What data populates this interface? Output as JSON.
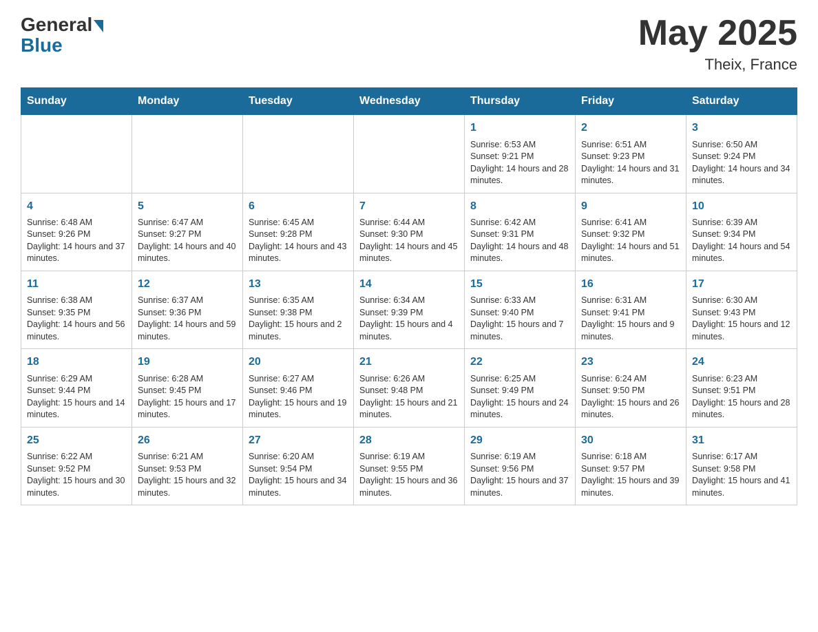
{
  "header": {
    "logo_general": "General",
    "logo_blue": "Blue",
    "title": "May 2025",
    "subtitle": "Theix, France"
  },
  "weekdays": [
    "Sunday",
    "Monday",
    "Tuesday",
    "Wednesday",
    "Thursday",
    "Friday",
    "Saturday"
  ],
  "weeks": [
    [
      {
        "day": "",
        "info": ""
      },
      {
        "day": "",
        "info": ""
      },
      {
        "day": "",
        "info": ""
      },
      {
        "day": "",
        "info": ""
      },
      {
        "day": "1",
        "info": "Sunrise: 6:53 AM\nSunset: 9:21 PM\nDaylight: 14 hours and 28 minutes."
      },
      {
        "day": "2",
        "info": "Sunrise: 6:51 AM\nSunset: 9:23 PM\nDaylight: 14 hours and 31 minutes."
      },
      {
        "day": "3",
        "info": "Sunrise: 6:50 AM\nSunset: 9:24 PM\nDaylight: 14 hours and 34 minutes."
      }
    ],
    [
      {
        "day": "4",
        "info": "Sunrise: 6:48 AM\nSunset: 9:26 PM\nDaylight: 14 hours and 37 minutes."
      },
      {
        "day": "5",
        "info": "Sunrise: 6:47 AM\nSunset: 9:27 PM\nDaylight: 14 hours and 40 minutes."
      },
      {
        "day": "6",
        "info": "Sunrise: 6:45 AM\nSunset: 9:28 PM\nDaylight: 14 hours and 43 minutes."
      },
      {
        "day": "7",
        "info": "Sunrise: 6:44 AM\nSunset: 9:30 PM\nDaylight: 14 hours and 45 minutes."
      },
      {
        "day": "8",
        "info": "Sunrise: 6:42 AM\nSunset: 9:31 PM\nDaylight: 14 hours and 48 minutes."
      },
      {
        "day": "9",
        "info": "Sunrise: 6:41 AM\nSunset: 9:32 PM\nDaylight: 14 hours and 51 minutes."
      },
      {
        "day": "10",
        "info": "Sunrise: 6:39 AM\nSunset: 9:34 PM\nDaylight: 14 hours and 54 minutes."
      }
    ],
    [
      {
        "day": "11",
        "info": "Sunrise: 6:38 AM\nSunset: 9:35 PM\nDaylight: 14 hours and 56 minutes."
      },
      {
        "day": "12",
        "info": "Sunrise: 6:37 AM\nSunset: 9:36 PM\nDaylight: 14 hours and 59 minutes."
      },
      {
        "day": "13",
        "info": "Sunrise: 6:35 AM\nSunset: 9:38 PM\nDaylight: 15 hours and 2 minutes."
      },
      {
        "day": "14",
        "info": "Sunrise: 6:34 AM\nSunset: 9:39 PM\nDaylight: 15 hours and 4 minutes."
      },
      {
        "day": "15",
        "info": "Sunrise: 6:33 AM\nSunset: 9:40 PM\nDaylight: 15 hours and 7 minutes."
      },
      {
        "day": "16",
        "info": "Sunrise: 6:31 AM\nSunset: 9:41 PM\nDaylight: 15 hours and 9 minutes."
      },
      {
        "day": "17",
        "info": "Sunrise: 6:30 AM\nSunset: 9:43 PM\nDaylight: 15 hours and 12 minutes."
      }
    ],
    [
      {
        "day": "18",
        "info": "Sunrise: 6:29 AM\nSunset: 9:44 PM\nDaylight: 15 hours and 14 minutes."
      },
      {
        "day": "19",
        "info": "Sunrise: 6:28 AM\nSunset: 9:45 PM\nDaylight: 15 hours and 17 minutes."
      },
      {
        "day": "20",
        "info": "Sunrise: 6:27 AM\nSunset: 9:46 PM\nDaylight: 15 hours and 19 minutes."
      },
      {
        "day": "21",
        "info": "Sunrise: 6:26 AM\nSunset: 9:48 PM\nDaylight: 15 hours and 21 minutes."
      },
      {
        "day": "22",
        "info": "Sunrise: 6:25 AM\nSunset: 9:49 PM\nDaylight: 15 hours and 24 minutes."
      },
      {
        "day": "23",
        "info": "Sunrise: 6:24 AM\nSunset: 9:50 PM\nDaylight: 15 hours and 26 minutes."
      },
      {
        "day": "24",
        "info": "Sunrise: 6:23 AM\nSunset: 9:51 PM\nDaylight: 15 hours and 28 minutes."
      }
    ],
    [
      {
        "day": "25",
        "info": "Sunrise: 6:22 AM\nSunset: 9:52 PM\nDaylight: 15 hours and 30 minutes."
      },
      {
        "day": "26",
        "info": "Sunrise: 6:21 AM\nSunset: 9:53 PM\nDaylight: 15 hours and 32 minutes."
      },
      {
        "day": "27",
        "info": "Sunrise: 6:20 AM\nSunset: 9:54 PM\nDaylight: 15 hours and 34 minutes."
      },
      {
        "day": "28",
        "info": "Sunrise: 6:19 AM\nSunset: 9:55 PM\nDaylight: 15 hours and 36 minutes."
      },
      {
        "day": "29",
        "info": "Sunrise: 6:19 AM\nSunset: 9:56 PM\nDaylight: 15 hours and 37 minutes."
      },
      {
        "day": "30",
        "info": "Sunrise: 6:18 AM\nSunset: 9:57 PM\nDaylight: 15 hours and 39 minutes."
      },
      {
        "day": "31",
        "info": "Sunrise: 6:17 AM\nSunset: 9:58 PM\nDaylight: 15 hours and 41 minutes."
      }
    ]
  ]
}
